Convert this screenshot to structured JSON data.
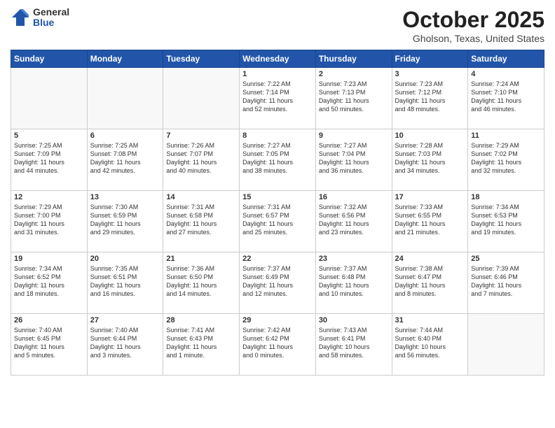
{
  "logo": {
    "general": "General",
    "blue": "Blue"
  },
  "header": {
    "month": "October 2025",
    "location": "Gholson, Texas, United States"
  },
  "weekdays": [
    "Sunday",
    "Monday",
    "Tuesday",
    "Wednesday",
    "Thursday",
    "Friday",
    "Saturday"
  ],
  "weeks": [
    [
      {
        "day": "",
        "info": ""
      },
      {
        "day": "",
        "info": ""
      },
      {
        "day": "",
        "info": ""
      },
      {
        "day": "1",
        "info": "Sunrise: 7:22 AM\nSunset: 7:14 PM\nDaylight: 11 hours\nand 52 minutes."
      },
      {
        "day": "2",
        "info": "Sunrise: 7:23 AM\nSunset: 7:13 PM\nDaylight: 11 hours\nand 50 minutes."
      },
      {
        "day": "3",
        "info": "Sunrise: 7:23 AM\nSunset: 7:12 PM\nDaylight: 11 hours\nand 48 minutes."
      },
      {
        "day": "4",
        "info": "Sunrise: 7:24 AM\nSunset: 7:10 PM\nDaylight: 11 hours\nand 46 minutes."
      }
    ],
    [
      {
        "day": "5",
        "info": "Sunrise: 7:25 AM\nSunset: 7:09 PM\nDaylight: 11 hours\nand 44 minutes."
      },
      {
        "day": "6",
        "info": "Sunrise: 7:25 AM\nSunset: 7:08 PM\nDaylight: 11 hours\nand 42 minutes."
      },
      {
        "day": "7",
        "info": "Sunrise: 7:26 AM\nSunset: 7:07 PM\nDaylight: 11 hours\nand 40 minutes."
      },
      {
        "day": "8",
        "info": "Sunrise: 7:27 AM\nSunset: 7:05 PM\nDaylight: 11 hours\nand 38 minutes."
      },
      {
        "day": "9",
        "info": "Sunrise: 7:27 AM\nSunset: 7:04 PM\nDaylight: 11 hours\nand 36 minutes."
      },
      {
        "day": "10",
        "info": "Sunrise: 7:28 AM\nSunset: 7:03 PM\nDaylight: 11 hours\nand 34 minutes."
      },
      {
        "day": "11",
        "info": "Sunrise: 7:29 AM\nSunset: 7:02 PM\nDaylight: 11 hours\nand 32 minutes."
      }
    ],
    [
      {
        "day": "12",
        "info": "Sunrise: 7:29 AM\nSunset: 7:00 PM\nDaylight: 11 hours\nand 31 minutes."
      },
      {
        "day": "13",
        "info": "Sunrise: 7:30 AM\nSunset: 6:59 PM\nDaylight: 11 hours\nand 29 minutes."
      },
      {
        "day": "14",
        "info": "Sunrise: 7:31 AM\nSunset: 6:58 PM\nDaylight: 11 hours\nand 27 minutes."
      },
      {
        "day": "15",
        "info": "Sunrise: 7:31 AM\nSunset: 6:57 PM\nDaylight: 11 hours\nand 25 minutes."
      },
      {
        "day": "16",
        "info": "Sunrise: 7:32 AM\nSunset: 6:56 PM\nDaylight: 11 hours\nand 23 minutes."
      },
      {
        "day": "17",
        "info": "Sunrise: 7:33 AM\nSunset: 6:55 PM\nDaylight: 11 hours\nand 21 minutes."
      },
      {
        "day": "18",
        "info": "Sunrise: 7:34 AM\nSunset: 6:53 PM\nDaylight: 11 hours\nand 19 minutes."
      }
    ],
    [
      {
        "day": "19",
        "info": "Sunrise: 7:34 AM\nSunset: 6:52 PM\nDaylight: 11 hours\nand 18 minutes."
      },
      {
        "day": "20",
        "info": "Sunrise: 7:35 AM\nSunset: 6:51 PM\nDaylight: 11 hours\nand 16 minutes."
      },
      {
        "day": "21",
        "info": "Sunrise: 7:36 AM\nSunset: 6:50 PM\nDaylight: 11 hours\nand 14 minutes."
      },
      {
        "day": "22",
        "info": "Sunrise: 7:37 AM\nSunset: 6:49 PM\nDaylight: 11 hours\nand 12 minutes."
      },
      {
        "day": "23",
        "info": "Sunrise: 7:37 AM\nSunset: 6:48 PM\nDaylight: 11 hours\nand 10 minutes."
      },
      {
        "day": "24",
        "info": "Sunrise: 7:38 AM\nSunset: 6:47 PM\nDaylight: 11 hours\nand 8 minutes."
      },
      {
        "day": "25",
        "info": "Sunrise: 7:39 AM\nSunset: 6:46 PM\nDaylight: 11 hours\nand 7 minutes."
      }
    ],
    [
      {
        "day": "26",
        "info": "Sunrise: 7:40 AM\nSunset: 6:45 PM\nDaylight: 11 hours\nand 5 minutes."
      },
      {
        "day": "27",
        "info": "Sunrise: 7:40 AM\nSunset: 6:44 PM\nDaylight: 11 hours\nand 3 minutes."
      },
      {
        "day": "28",
        "info": "Sunrise: 7:41 AM\nSunset: 6:43 PM\nDaylight: 11 hours\nand 1 minute."
      },
      {
        "day": "29",
        "info": "Sunrise: 7:42 AM\nSunset: 6:42 PM\nDaylight: 11 hours\nand 0 minutes."
      },
      {
        "day": "30",
        "info": "Sunrise: 7:43 AM\nSunset: 6:41 PM\nDaylight: 10 hours\nand 58 minutes."
      },
      {
        "day": "31",
        "info": "Sunrise: 7:44 AM\nSunset: 6:40 PM\nDaylight: 10 hours\nand 56 minutes."
      },
      {
        "day": "",
        "info": ""
      }
    ]
  ]
}
